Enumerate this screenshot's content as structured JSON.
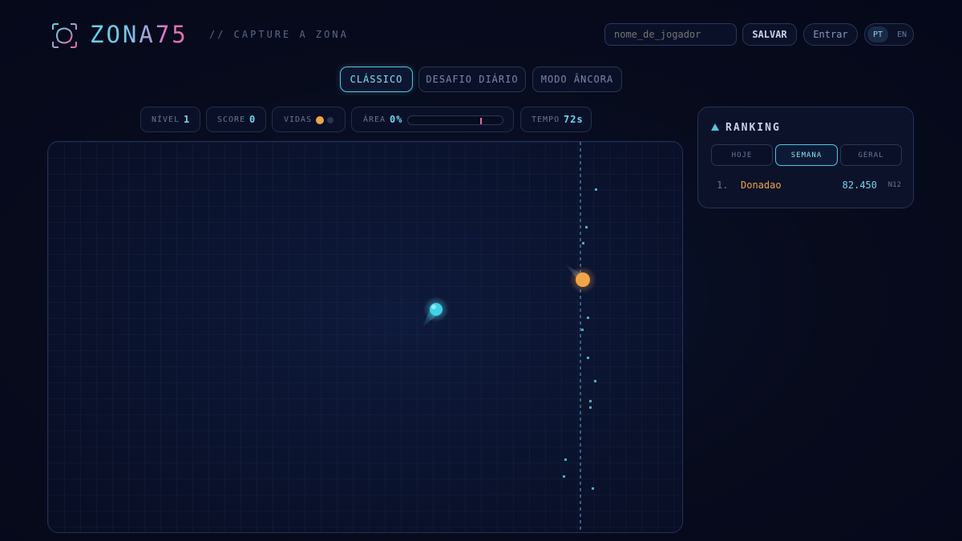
{
  "header": {
    "logo_icon": "zone-capture-icon",
    "title": "ZONA75",
    "tagline": "// CAPTURE A ZONA",
    "name_placeholder": "nome_de_jogador",
    "save_label": "SALVAR",
    "login_label": "Entrar",
    "lang_pt": "PT",
    "lang_en": "EN",
    "active_lang": "PT"
  },
  "modes": [
    {
      "label": "CLÁSSICO",
      "active": true
    },
    {
      "label": "DESAFIO DIÁRIO",
      "active": false
    },
    {
      "label": "MODO ÂNCORA",
      "active": false
    }
  ],
  "stats": {
    "level_label": "NÍVEL",
    "level_value": "1",
    "score_label": "SCORE",
    "score_value": "0",
    "lives_label": "VIDAS",
    "lives_total": 2,
    "lives_remaining": 1,
    "area_label": "ÁREA",
    "area_value": "0%",
    "area_progress": 0,
    "area_target_fraction": 0.75,
    "time_label": "TEMPO",
    "time_value": "72s"
  },
  "ranking": {
    "title": "RANKING",
    "tabs": [
      {
        "label": "HOJE",
        "active": false
      },
      {
        "label": "SEMANA",
        "active": true
      },
      {
        "label": "GERAL",
        "active": false
      }
    ],
    "entries": [
      {
        "position": "1.",
        "name": "Donadao",
        "score": "82.450",
        "level": "N12"
      }
    ]
  },
  "colors": {
    "accent_cyan": "#4fc7e0",
    "accent_pink": "#e36aa8",
    "enemy_orange": "#f1a548",
    "player_cyan": "#3fd3ea"
  }
}
